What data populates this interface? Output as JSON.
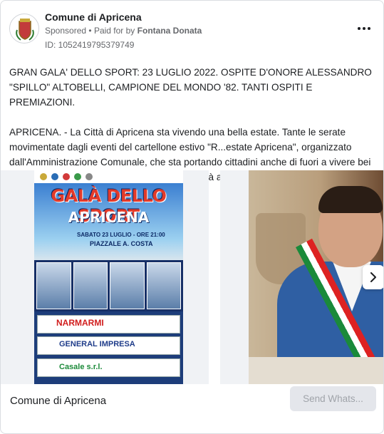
{
  "ad": {
    "page_name": "Comune di Apricena",
    "sponsored_label": "Sponsored",
    "separator": "•",
    "paid_for_prefix": "Paid for by",
    "paid_for_by": "Fontana Donata",
    "ad_id": "ID: 1052419795379749",
    "more_icon": "more-horizontal-icon"
  },
  "body": {
    "headline": "GRAN GALA' DELLO SPORT: 23 LUGLIO 2022. OSPITE D'ONORE ALESSANDRO \"SPILLO\" ALTOBELLI, CAMPIONE DEL MONDO '82. TANTI OSPITI E PREMIAZIONI.",
    "paragraph": "APRICENA. - La Città di Apricena sta vivendo una bella estate. Tante le serate movimentate dagli eventi del cartellone estivo \"R...estate Apricena\", organizzato dall'Amministrazione Comunale, che sta portando cittadini anche di fuori a vivere bei momenti di svago e divertimento nella comunità apricenese...."
  },
  "carousel": {
    "slides": [
      {
        "type": "poster",
        "title": "GALÀ DELLO SPORT",
        "subtitle": "APRICENA",
        "date_line": "SABATO 23 LUGLIO - ORE 21:00",
        "place_line": "PIAZZALE A. COSTA",
        "sponsors": [
          "NARMARMI",
          "GENERAL IMPRESA",
          "Casale s.r.l."
        ]
      },
      {
        "type": "photo"
      }
    ],
    "next_icon": "chevron-right-icon"
  },
  "footer": {
    "page_name": "Comune di Apricena",
    "cta_label": "Send Whats..."
  }
}
